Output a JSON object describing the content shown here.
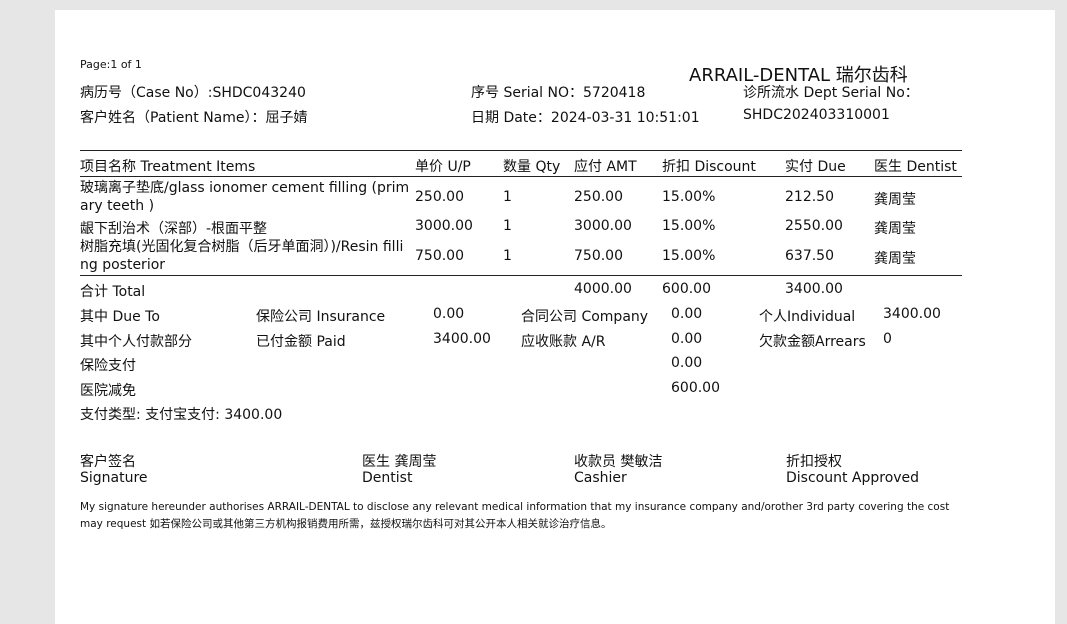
{
  "header": {
    "page_info": "Page:1 of 1",
    "brand": "ARRAIL-DENTAL   瑞尔齿科",
    "case_no": "病历号（Case No）:SHDC043240",
    "serial_no": "序号 Serial NO：5720418",
    "dept_serial_label": "诊所流水 Dept Serial No：",
    "patient_name": "客户姓名（Patient Name）：屈子婧",
    "date": "日期 Date：2024-03-31 10:51:01",
    "dept_serial_value": "SHDC202403310001"
  },
  "table": {
    "headers": {
      "item": "项目名称 Treatment Items",
      "unit_price": "单价 U/P",
      "qty": "数量 Qty",
      "amount": "应付 AMT",
      "discount": "折扣 Discount",
      "due": "实付 Due",
      "dentist": "医生 Dentist"
    },
    "rows": [
      {
        "item": "玻璃离子垫底/glass ionomer cement filling (primary teeth )",
        "unit_price": "250.00",
        "qty": "1",
        "amount": "250.00",
        "discount": "15.00%",
        "due": "212.50",
        "dentist": "龚周莹"
      },
      {
        "item": "龈下刮治术（深部）-根面平整",
        "unit_price": "3000.00",
        "qty": "1",
        "amount": "3000.00",
        "discount": "15.00%",
        "due": "2550.00",
        "dentist": "龚周莹"
      },
      {
        "item": "树脂充填(光固化复合树脂（后牙单面洞）)/Resin filling posterior",
        "unit_price": "750.00",
        "qty": "1",
        "amount": "750.00",
        "discount": "15.00%",
        "due": "637.50",
        "dentist": "龚周莹"
      }
    ]
  },
  "totals": {
    "label": "合计 Total",
    "amount": "4000.00",
    "discount": "600.00",
    "due": "3400.00"
  },
  "breakdown": {
    "due_to_label": "其中 Due To",
    "insurance_label": "保险公司 Insurance",
    "insurance_value": "0.00",
    "company_label": "合同公司 Company",
    "company_value": "0.00",
    "individual_label": "个人Individual",
    "individual_value": "3400.00",
    "personal_part_label": "其中个人付款部分",
    "paid_label": "已付金额 Paid",
    "paid_value": "3400.00",
    "ar_label": "应收账款 A/R",
    "ar_value": "0.00",
    "arrears_label": "欠款金额Arrears",
    "arrears_value": "0",
    "insurance_pay_label": "保险支付",
    "insurance_pay_value": "0.00",
    "hospital_reduction_label": "医院减免",
    "hospital_reduction_value": "600.00",
    "payment_type": "支付类型:   支付宝支付:   3400.00"
  },
  "signatures": {
    "customer_cn": "客户签名",
    "customer_en": "Signature",
    "dentist_cn": "医生 龚周莹",
    "dentist_en": "Dentist",
    "cashier_cn": "收款员 樊敏洁",
    "cashier_en": "Cashier",
    "discount_cn": "折扣授权",
    "discount_en": "Discount Approved"
  },
  "disclaimer": "My signature hereunder authorises ARRAIL-DENTAL to disclose any relevant medical information that my insurance company and/orother 3rd party covering the cost may request 如若保险公司或其他第三方机构报销费用所需，兹授权瑞尔齿科可对其公开本人相关就诊治疗信息。"
}
